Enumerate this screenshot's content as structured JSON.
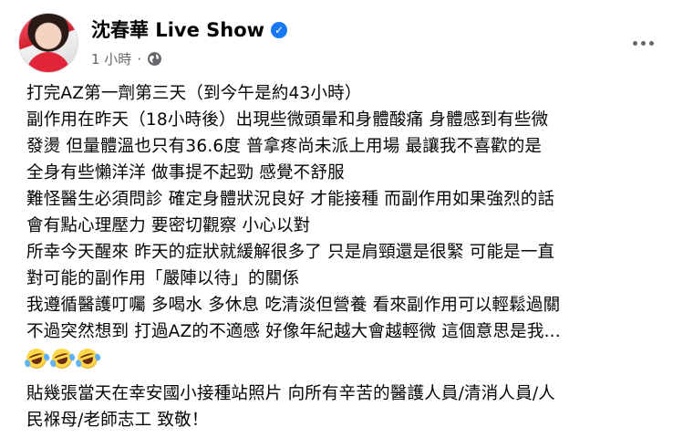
{
  "post": {
    "author": "沈春華 Live Show",
    "timestamp": "1 小時",
    "separator": "·",
    "body_lines": [
      "打完AZ第一劑第三天（到今午是約43小時）",
      "副作用在昨天（18小時後）出現些微頭暈和身體酸痛 身體感到有些微",
      "發燙 但量體溫也只有36.6度 普拿疼尚未派上用場  最讓我不喜歡的是",
      "全身有些懶洋洋 做事提不起勁 感覺不舒服",
      "難怪醫生必須問診 確定身體狀況良好 才能接種 而副作用如果強烈的話",
      "會有點心理壓力 要密切觀察 小心以對",
      "所幸今天醒來 昨天的症狀就緩解很多了 只是肩頸還是很緊 可能是一直",
      "對可能的副作用「嚴陣以待」的關係",
      "我遵循醫護叮囑 多喝水 多休息 吃清淡但營養 看來副作用可以輕鬆過關",
      "不過突然想到 打過AZ的不適感 好像年紀越大會越輕微 這個意思是我..."
    ],
    "emoji_count": 3,
    "emoji_name": "rolling-on-the-floor-laughing",
    "closing_lines": [
      "貼幾張當天在幸安國小接種站照片 向所有辛苦的醫護人員/清消人員/人",
      "民褓母/老師志工 致敬！"
    ]
  },
  "icons": {
    "verified": "verified-badge-icon",
    "privacy": "globe-icon",
    "more": "more-options-icon"
  },
  "colors": {
    "verified_blue": "#1877f2",
    "meta_gray": "#65676b",
    "text": "#050505"
  }
}
